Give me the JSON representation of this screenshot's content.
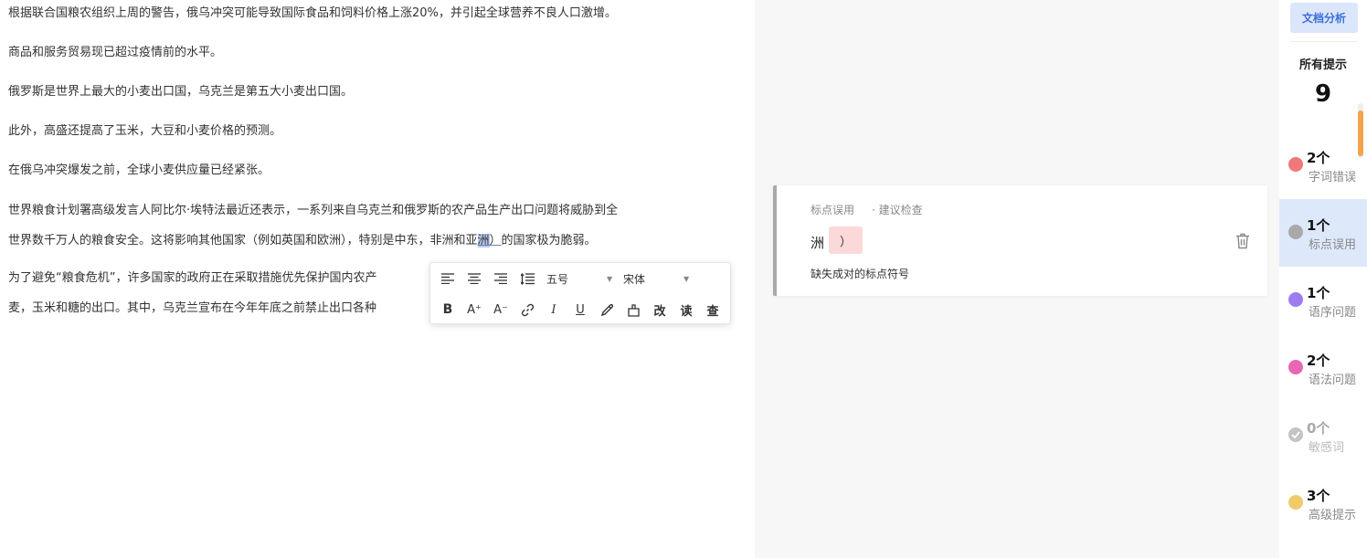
{
  "editor": {
    "paragraphs": [
      "根据联合国粮农组织上周的警告，俄乌冲突可能导致国际食品和饲料价格上涨20%，并引起全球营养不良人口激增。",
      "商品和服务贸易现已超过疫情前的水平。",
      "俄罗斯是世界上最大的小麦出口国，乌克兰是第五大小麦出口国。",
      "此外，高盛还提高了玉米，大豆和小麦价格的预测。",
      "在俄乌冲突爆发之前，全球小麦供应量已经紧张。"
    ],
    "p6_line1": "世界粮食计划署高级发言人阿比尔·埃特法最近还表示，一系列来自乌克兰和俄罗斯的农产品生产出口问题将威胁到全",
    "p6_line2_a": "世界数千万人的粮食安全。这将影响其他国家（例如英国和欧洲），特别是中东，非洲和亚",
    "p6_line2_sel": "洲",
    "p6_line2_b": "）",
    "p6_line2_c": "的国家极为脆弱。",
    "p7_line1": "为了避免“粮食危机”，许多国家的政府正在采取措施优先保护国内农产",
    "p7_line2": "麦，玉米和糖的出口。其中，乌克兰宣布在今年年底之前禁止出口各种"
  },
  "toolbar": {
    "font_size": "五号",
    "font_family": "宋体",
    "bold": "B",
    "font_up": "A⁺",
    "font_down": "A⁻",
    "italic": "I",
    "underline": "U",
    "correct": "改",
    "read": "读",
    "check": "查"
  },
  "card": {
    "type": "标点误用",
    "hint": "· 建议检查",
    "word": "洲",
    "suggestion": "）",
    "description": "缺失成对的标点符号"
  },
  "sidebar": {
    "analyze_button": "文档分析",
    "all_label": "所有提示",
    "all_count": "9",
    "categories": [
      {
        "count": "2个",
        "label": "字词错误",
        "color": "#f07878"
      },
      {
        "count": "1个",
        "label": "标点误用",
        "color": "#a9a9a9"
      },
      {
        "count": "1个",
        "label": "语序问题",
        "color": "#9d7cf2"
      },
      {
        "count": "2个",
        "label": "语法问题",
        "color": "#e966b5"
      },
      {
        "count": "0个",
        "label": "敏感词",
        "color": "#c4c4c4"
      },
      {
        "count": "3个",
        "label": "高级提示",
        "color": "#efcb6b"
      }
    ]
  }
}
